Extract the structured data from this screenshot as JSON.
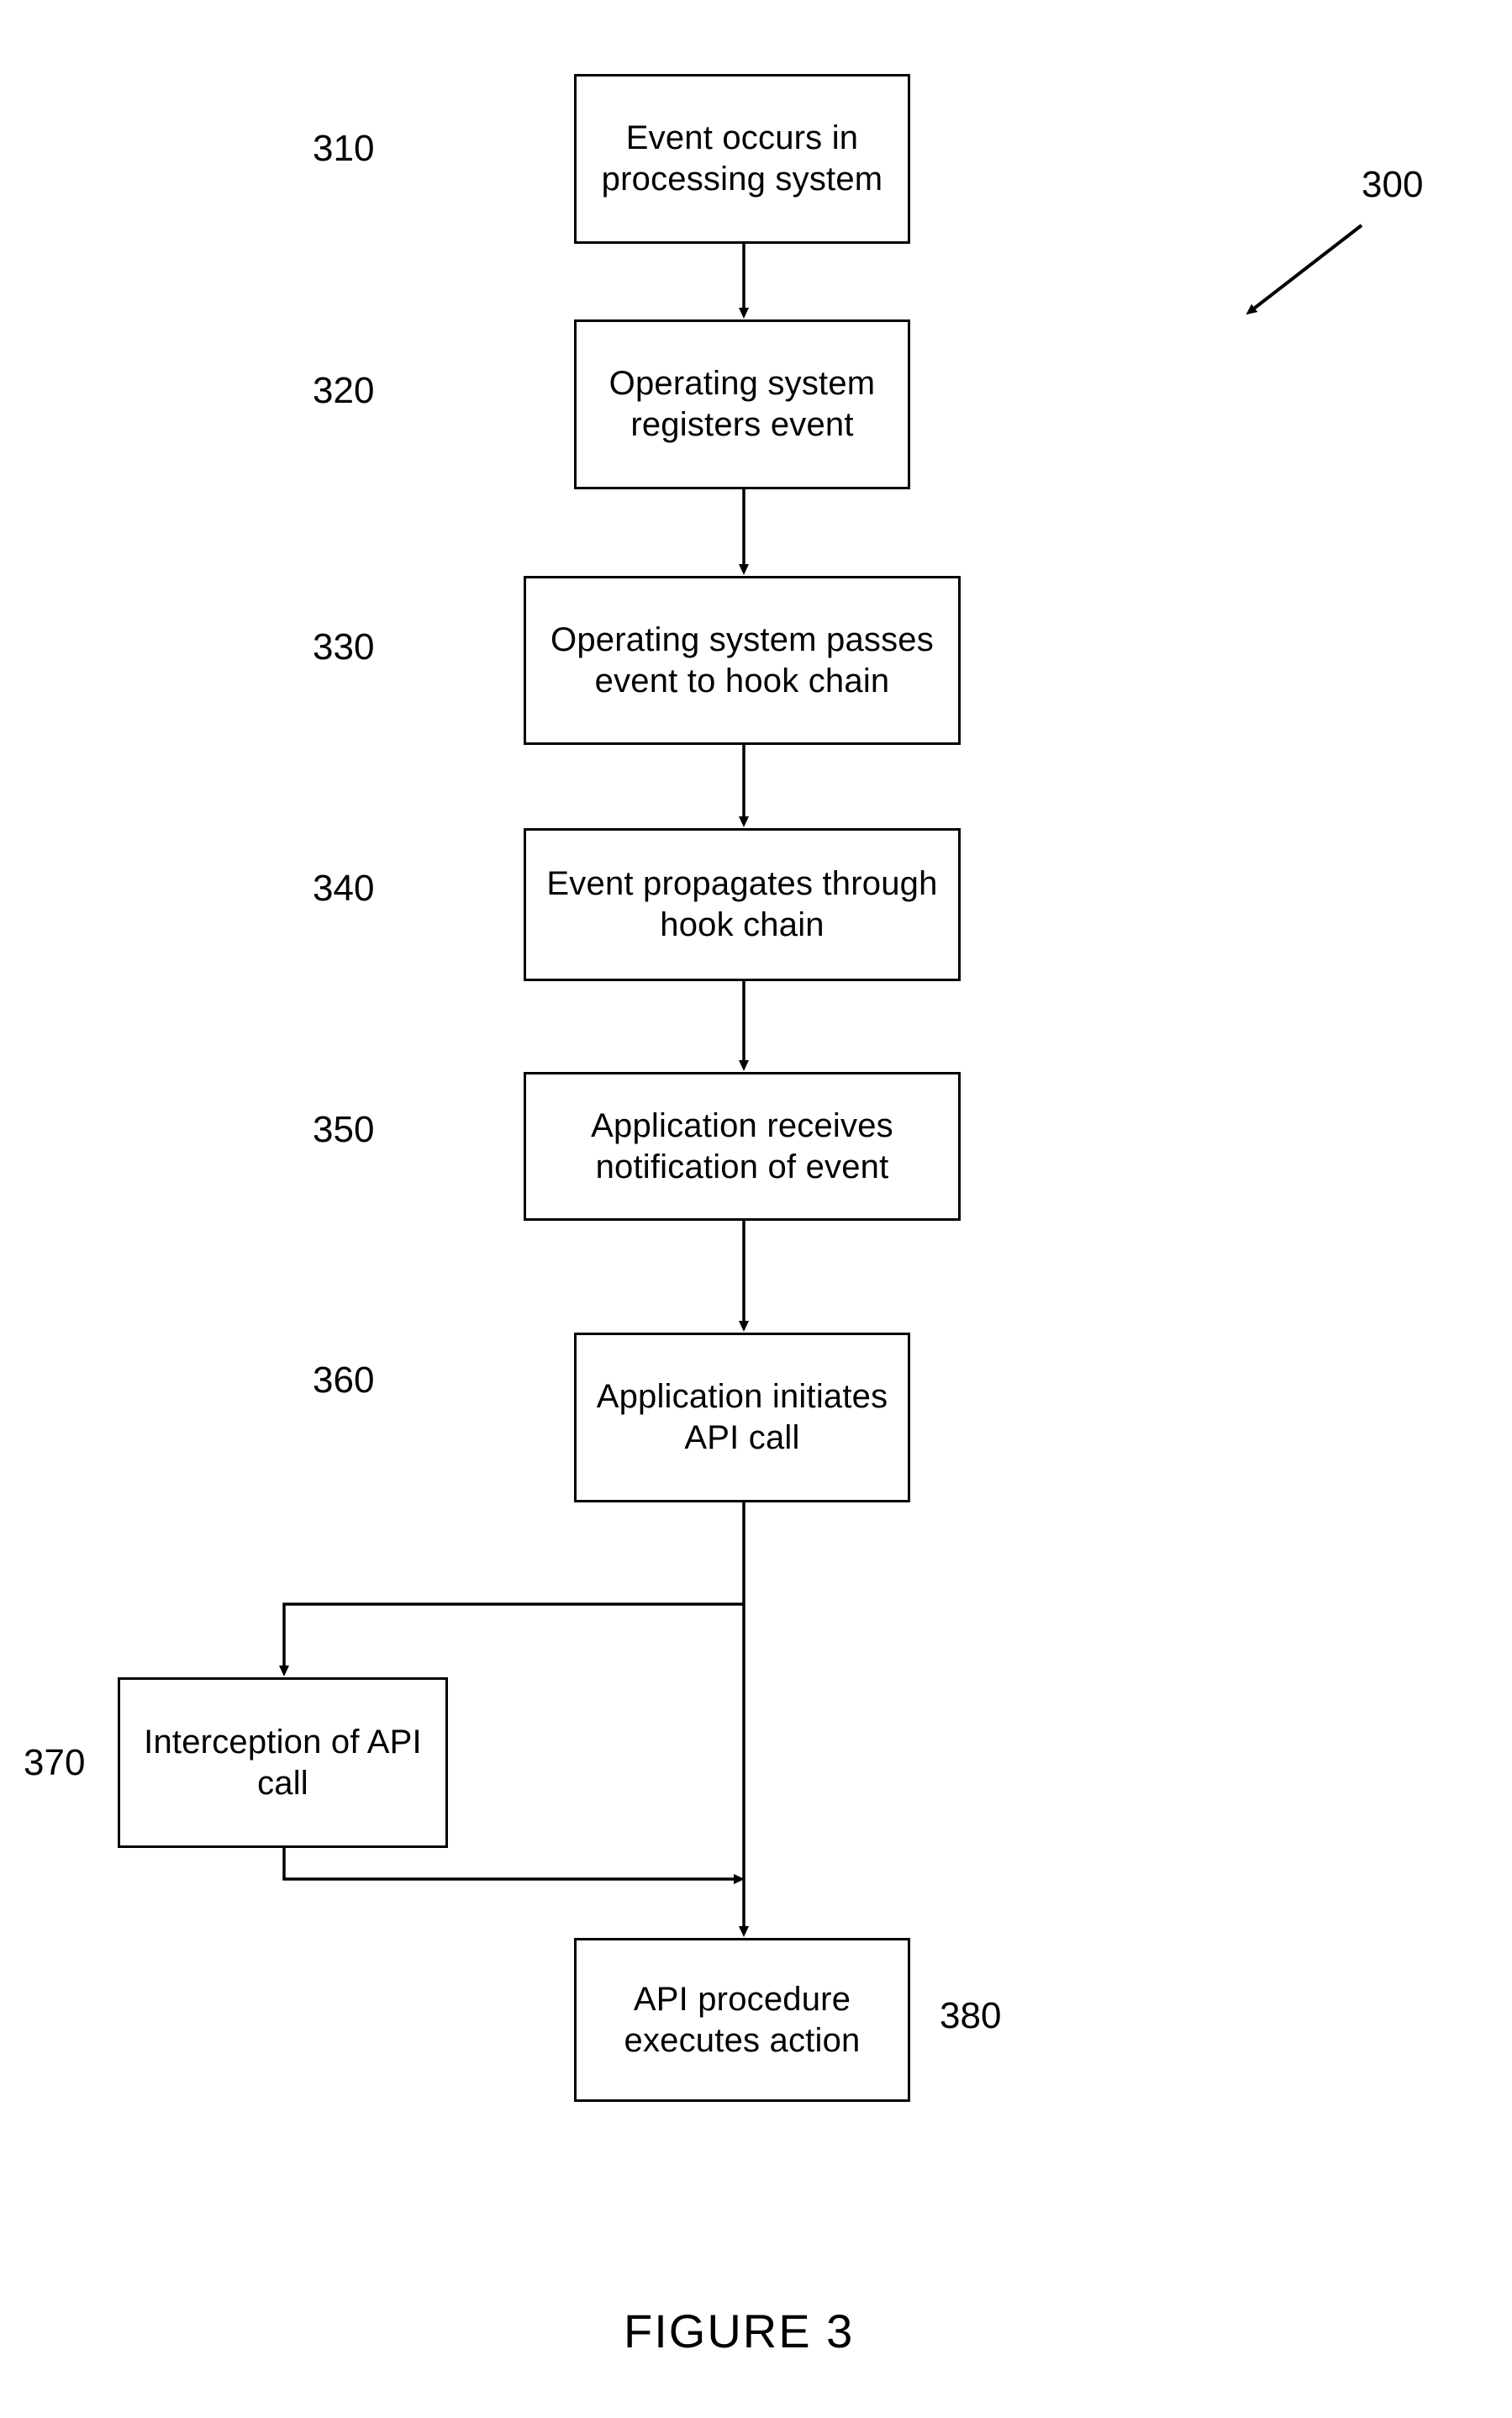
{
  "figure": {
    "caption": "FIGURE 3",
    "diagram_ref": "300"
  },
  "nodes": [
    {
      "ref": "310",
      "text": "Event occurs in processing system"
    },
    {
      "ref": "320",
      "text": "Operating system registers event"
    },
    {
      "ref": "330",
      "text": "Operating system passes event to hook chain"
    },
    {
      "ref": "340",
      "text": "Event propagates through hook chain"
    },
    {
      "ref": "350",
      "text": "Application receives notification of event"
    },
    {
      "ref": "360",
      "text": "Application initiates API call"
    },
    {
      "ref": "370",
      "text": "Interception of API call"
    },
    {
      "ref": "380",
      "text": "API procedure executes action"
    }
  ],
  "chart_data": {
    "type": "diagram",
    "title": "FIGURE 3",
    "diagram_ref": "300",
    "orientation": "top-to-bottom flowchart",
    "steps": [
      {
        "id": "310",
        "label": "Event occurs in processing system"
      },
      {
        "id": "320",
        "label": "Operating system registers event"
      },
      {
        "id": "330",
        "label": "Operating system passes event to hook chain"
      },
      {
        "id": "340",
        "label": "Event propagates through hook chain"
      },
      {
        "id": "350",
        "label": "Application receives notification of event"
      },
      {
        "id": "360",
        "label": "Application initiates API call"
      },
      {
        "id": "370",
        "label": "Interception of API call"
      },
      {
        "id": "380",
        "label": "API procedure executes action"
      }
    ],
    "edges": [
      {
        "from": "310",
        "to": "320",
        "style": "arrow"
      },
      {
        "from": "320",
        "to": "330",
        "style": "arrow"
      },
      {
        "from": "330",
        "to": "340",
        "style": "arrow"
      },
      {
        "from": "340",
        "to": "350",
        "style": "arrow"
      },
      {
        "from": "350",
        "to": "360",
        "style": "arrow"
      },
      {
        "from": "360",
        "to": "370",
        "style": "branch-left-arrow"
      },
      {
        "from": "370",
        "to": "380",
        "style": "return-right-arrow"
      }
    ]
  }
}
